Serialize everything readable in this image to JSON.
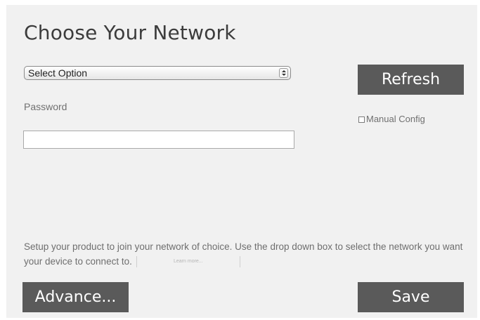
{
  "header": {
    "title": "Choose Your Network"
  },
  "network_select": {
    "selected": "Select Option"
  },
  "password": {
    "label": "Password",
    "value": ""
  },
  "buttons": {
    "refresh": "Refresh",
    "advance": "Advance...",
    "save": "Save"
  },
  "manual_config": {
    "label": "Manual Config",
    "checked": false
  },
  "description": {
    "text": "Setup your product to join your network of choice. Use the drop down box to select the network you want your device to connect to.",
    "learn_more": "Learn more..."
  },
  "colors": {
    "panel_background": "#f1f1f1",
    "button_background": "#5a5a5a",
    "button_text": "#ffffff",
    "title_text": "#3c3c3c"
  }
}
